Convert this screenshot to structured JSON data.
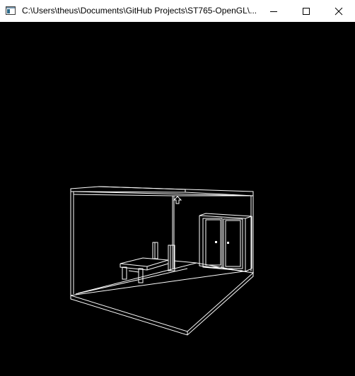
{
  "window": {
    "title": "C:\\Users\\theus\\Documents\\GitHub Projects\\ST765-OpenGL\\...",
    "app_icon": "console-app-icon",
    "controls": {
      "minimize": "minimize-icon",
      "maximize": "maximize-icon",
      "close": "close-icon"
    }
  },
  "scene": {
    "render_mode": "wireframe",
    "background": "#000000",
    "line_color": "#ffffff",
    "objects": [
      "room-floor",
      "room-walls",
      "ceiling-frame",
      "wardrobe",
      "desk",
      "column",
      "ceiling-lamp"
    ]
  }
}
